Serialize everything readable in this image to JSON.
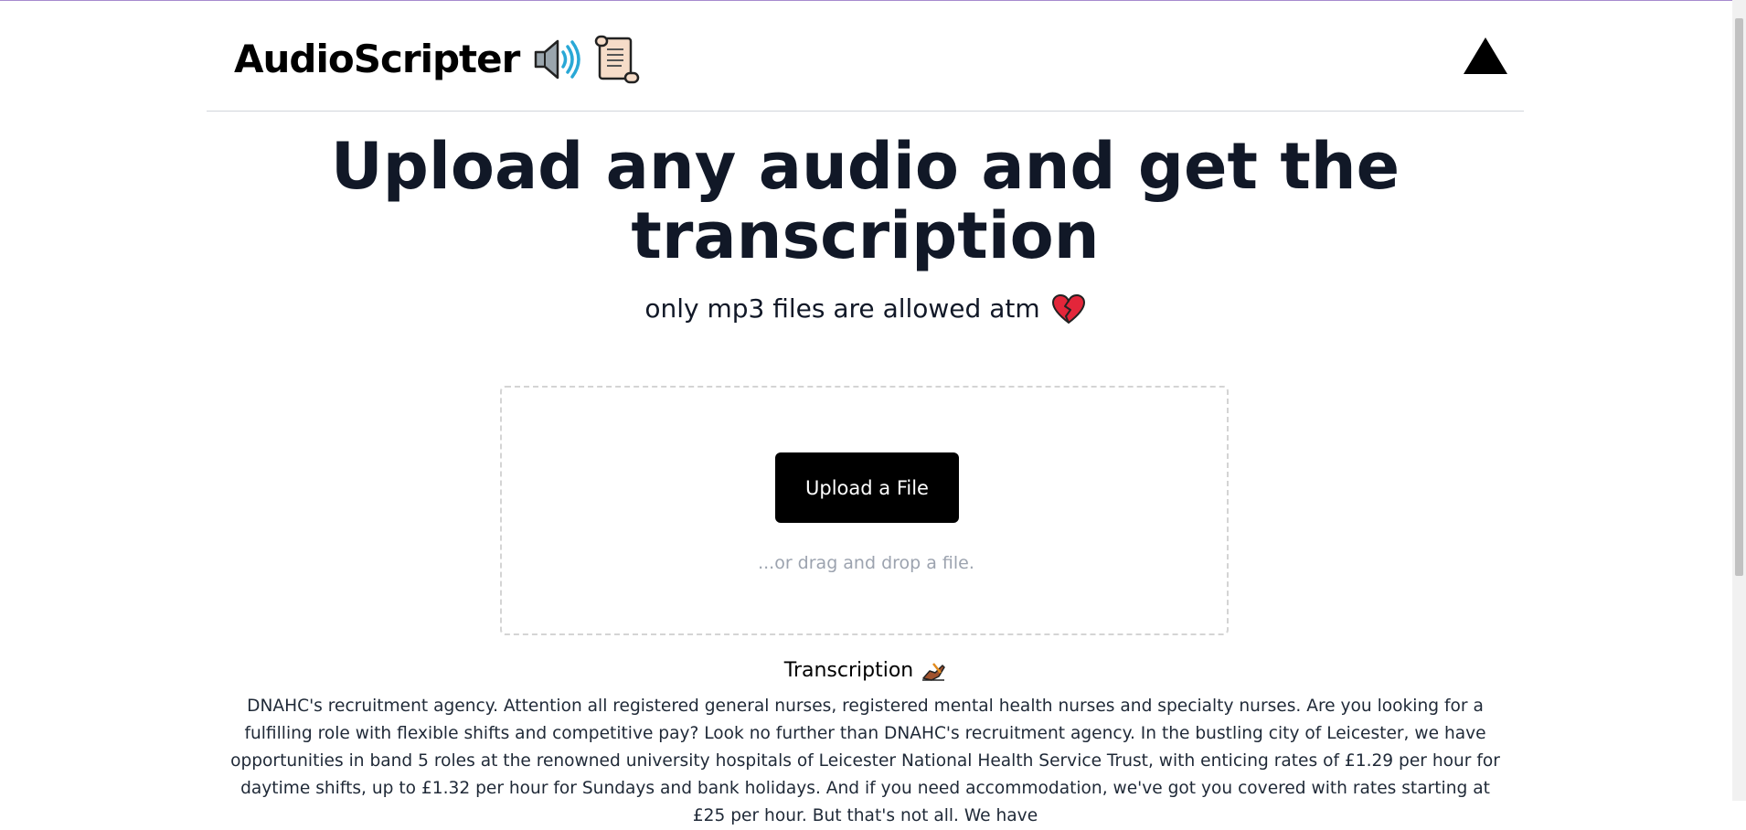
{
  "header": {
    "brand_title": "AudioScripter",
    "brand_icons": [
      "speaker-high-volume-icon",
      "scroll-icon"
    ],
    "menu_icon": "triangle-up-icon"
  },
  "hero": {
    "title_line1": "Upload any audio and get the",
    "title_line2": "transcription",
    "subtitle": "only mp3 files are allowed atm",
    "subtitle_icon": "broken-heart-icon"
  },
  "upload": {
    "button_label": "Upload a File",
    "drag_hint": "...or drag and drop a file."
  },
  "transcription": {
    "heading": "Transcription",
    "heading_icon": "writing-hand-icon",
    "text": "DNAHC's recruitment agency. Attention all registered general nurses, registered mental health nurses and specialty nurses. Are you looking for a fulfilling role with flexible shifts and competitive pay? Look no further than DNAHC's recruitment agency. In the bustling city of Leicester, we have opportunities in band 5 roles at the renowned university hospitals of Leicester National Health Service Trust, with enticing rates of £1.29 per hour for daytime shifts, up to £1.32 per hour for Sundays and bank holidays. And if you need accommodation, we've got you covered with rates starting at £25 per hour. But that's not all. We have"
  },
  "colors": {
    "title": "#111827",
    "button_bg": "#000000",
    "hint": "#9ca3af",
    "dropzone_border": "#d4d4d4"
  }
}
